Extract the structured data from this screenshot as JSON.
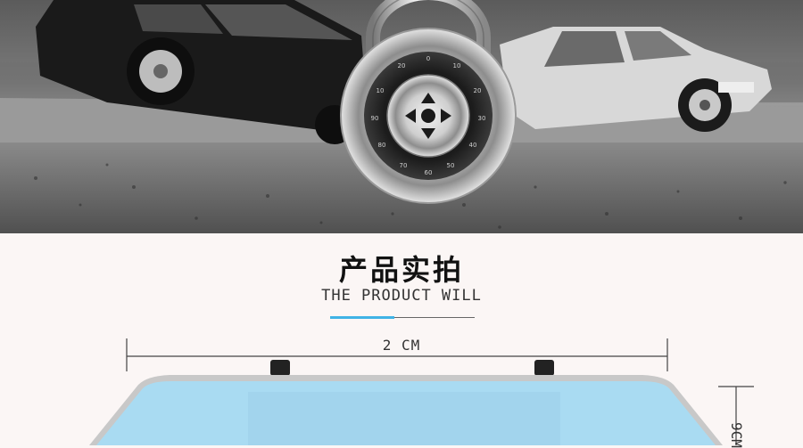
{
  "section": {
    "title": "产品实拍",
    "subtitle": "THE PRODUCT WILL"
  },
  "dimensions": {
    "width_label": "2 CM",
    "height_label": "9CM"
  },
  "colors": {
    "accent_line": "#3fb3e6",
    "mirror_glass": "#a9dbf2",
    "mirror_frame": "#c8c8c8",
    "background": "#fbf6f5"
  },
  "icons": {
    "padlock": "combination-padlock-icon"
  }
}
